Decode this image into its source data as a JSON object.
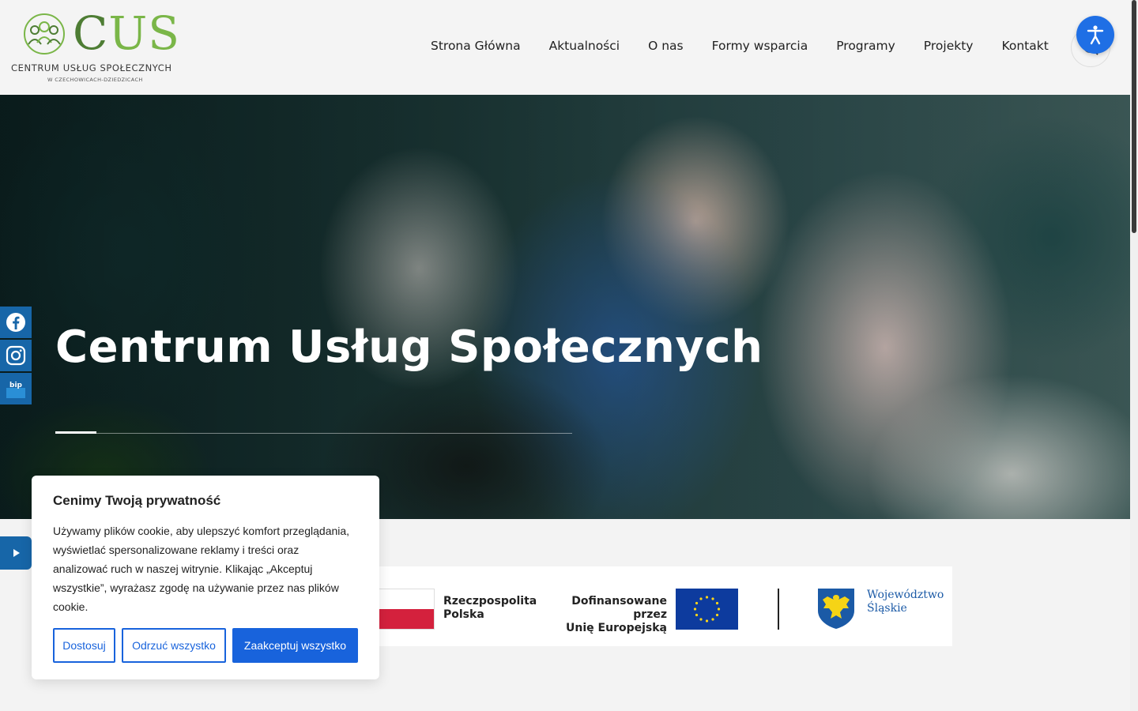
{
  "logo": {
    "title": "CUS",
    "name": "CENTRUM USŁUG SPOŁECZNYCH",
    "sub": "W CZECHOWICACH-DZIEDZICACH"
  },
  "nav": {
    "items": [
      "Strona Główna",
      "Aktualności",
      "O nas",
      "Formy wsparcia",
      "Programy",
      "Projekty",
      "Kontakt"
    ]
  },
  "icons": {
    "search": "search-icon",
    "accessibility": "accessibility-icon",
    "facebook": "facebook-icon",
    "instagram": "instagram-icon",
    "bip": "bip-icon",
    "play": "play-icon"
  },
  "social": {
    "bip_label": "bip"
  },
  "hero": {
    "title": "Centrum Usług Społecznych",
    "slider_progress": 0.08
  },
  "funding": {
    "rp_line1": "Rzeczpospolita",
    "rp_line2": "Polska",
    "eu_line1": "Dofinansowane przez",
    "eu_line2": "Unię Europejską",
    "woj_line1": "Województwo",
    "woj_line2": "Śląskie"
  },
  "cookie": {
    "title": "Cenimy Twoją prywatność",
    "text": "Używamy plików cookie, aby ulepszyć komfort przeglądania, wyświetlać spersonalizowane reklamy i treści oraz analizować ruch w naszej witrynie. Klikając „Akceptuj wszystkie”, wyrażasz zgodę na używanie przez nas plików cookie.",
    "customize": "Dostosuj",
    "reject": "Odrzuć wszystko",
    "accept": "Zaakceptuj wszystko"
  },
  "colors": {
    "accent_blue": "#1863dc",
    "social_blue": "#1766a8",
    "logo_green": "#7ab648"
  }
}
